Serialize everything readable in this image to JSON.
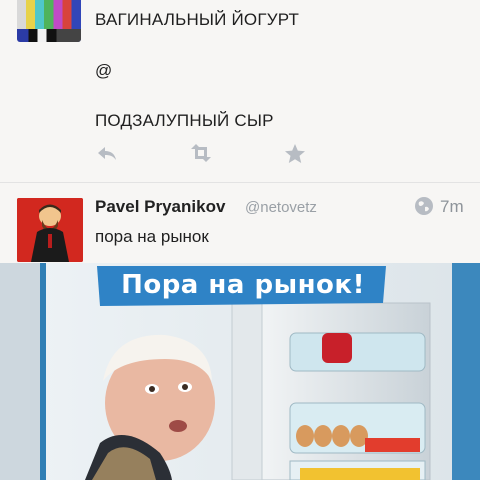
{
  "tweet1": {
    "line1": "ВАГИНАЛЬНЫЙ ЙОГУРТ",
    "line2": "@",
    "line3": "ПОДЗАЛУПНЫЙ СЫР",
    "actions": {
      "reply_icon": "reply-icon",
      "retweet_icon": "retweet-icon",
      "favorite_icon": "star-icon"
    }
  },
  "tweet2": {
    "name": "Pavel Pryanikov",
    "handle": "@netovetz",
    "time": "7m",
    "text": "пора на рынок",
    "globe_icon": "globe-icon"
  },
  "photo": {
    "banner": "Пора на рынок!"
  },
  "colors": {
    "accent_blue": "#1f6fa6",
    "icon_gray": "#b7bcc3",
    "avatar_red": "#d2281f"
  }
}
